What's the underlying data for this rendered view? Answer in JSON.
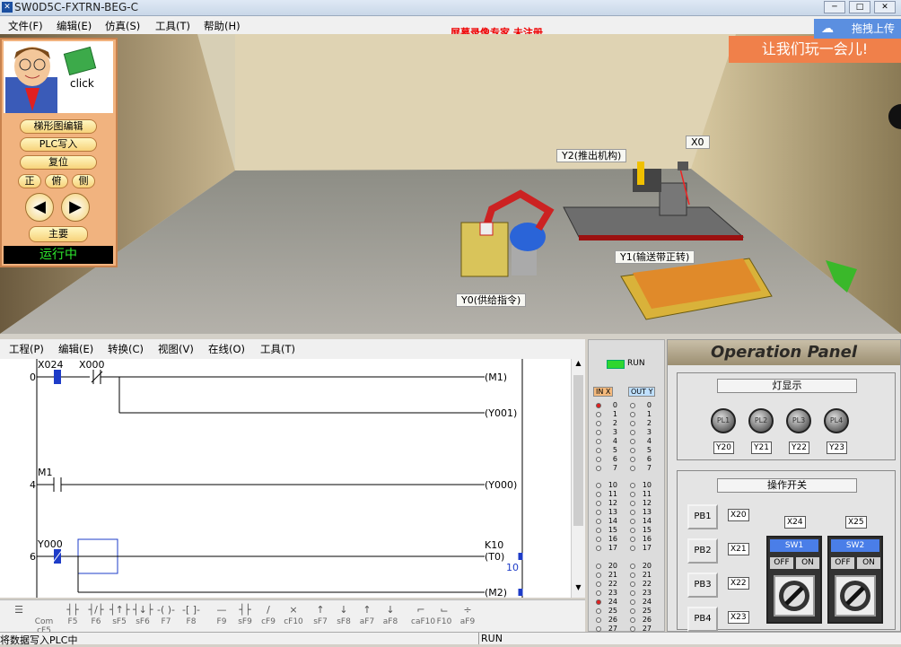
{
  "window": {
    "title": "SW0D5C-FXTRN-BEG-C"
  },
  "menu": [
    "文件(F)",
    "编辑(E)",
    "仿真(S)",
    "工具(T)",
    "帮助(H)"
  ],
  "watermark": "屏幕录像专家  未注册",
  "upload": {
    "label": "拖拽上传"
  },
  "banner": "让我们玩一会儿!",
  "side": {
    "click": "click",
    "buttons": [
      "梯形图编辑",
      "PLC写入",
      "复位"
    ],
    "views": [
      "正",
      "俯",
      "侧"
    ],
    "main": "主要",
    "status": "运行中"
  },
  "scene": {
    "labels": {
      "y2": "Y2(推出机构)",
      "x0": "X0",
      "y1": "Y1(输送带正转)",
      "y0": "Y0(供给指令)"
    }
  },
  "editor": {
    "menu": [
      "工程(P)",
      "编辑(E)",
      "转换(C)",
      "视图(V)",
      "在线(O)",
      "工具(T)"
    ]
  },
  "ladder": {
    "steps": [
      "0",
      "4",
      "6"
    ],
    "contacts": [
      "X024",
      "X000",
      "M1",
      "Y000"
    ],
    "coils": [
      "M1",
      "Y001",
      "Y000",
      "T0",
      "M2"
    ],
    "timer_k": "K10",
    "timer_val": "10"
  },
  "ftool": [
    "Com cF5",
    "F5",
    "F6",
    "sF5",
    "sF6",
    "F7",
    "F8",
    "F9",
    "sF9",
    "cF9",
    "cF10",
    "sF7",
    "sF8",
    "aF7",
    "aF8",
    "caF10",
    "F10",
    "aF9"
  ],
  "status": {
    "left": "将数据写入PLC中",
    "mid": "RUN"
  },
  "io": {
    "run": "RUN",
    "in": "IN X",
    "out": "OUT Y",
    "in_rows": [
      "0",
      "1",
      "2",
      "3",
      "4",
      "5",
      "6",
      "7",
      "10",
      "11",
      "12",
      "13",
      "14",
      "15",
      "16",
      "17",
      "20",
      "21",
      "22",
      "23",
      "24",
      "25",
      "26",
      "27"
    ],
    "out_rows": [
      "0",
      "1",
      "2",
      "3",
      "4",
      "5",
      "6",
      "7",
      "10",
      "11",
      "12",
      "13",
      "14",
      "15",
      "16",
      "17",
      "20",
      "21",
      "22",
      "23",
      "24",
      "25",
      "26",
      "27"
    ]
  },
  "op": {
    "title": "Operation Panel",
    "lights_title": "灯显示",
    "lamps": [
      "PL1",
      "PL2",
      "PL3",
      "PL4"
    ],
    "lamp_labels": [
      "Y20",
      "Y21",
      "Y22",
      "Y23"
    ],
    "sw_title": "操作开关",
    "pbs": [
      "PB1",
      "PB2",
      "PB3",
      "PB4"
    ],
    "pb_labels": [
      "X20",
      "X21",
      "X22",
      "X23"
    ],
    "sw_labels": [
      "X24",
      "X25"
    ],
    "sws": [
      "SW1",
      "SW2"
    ],
    "off": "OFF",
    "on": "ON"
  },
  "colors": {
    "side": "#f1b37f",
    "banner": "#f0804a",
    "status_run": "#2eea2e"
  }
}
